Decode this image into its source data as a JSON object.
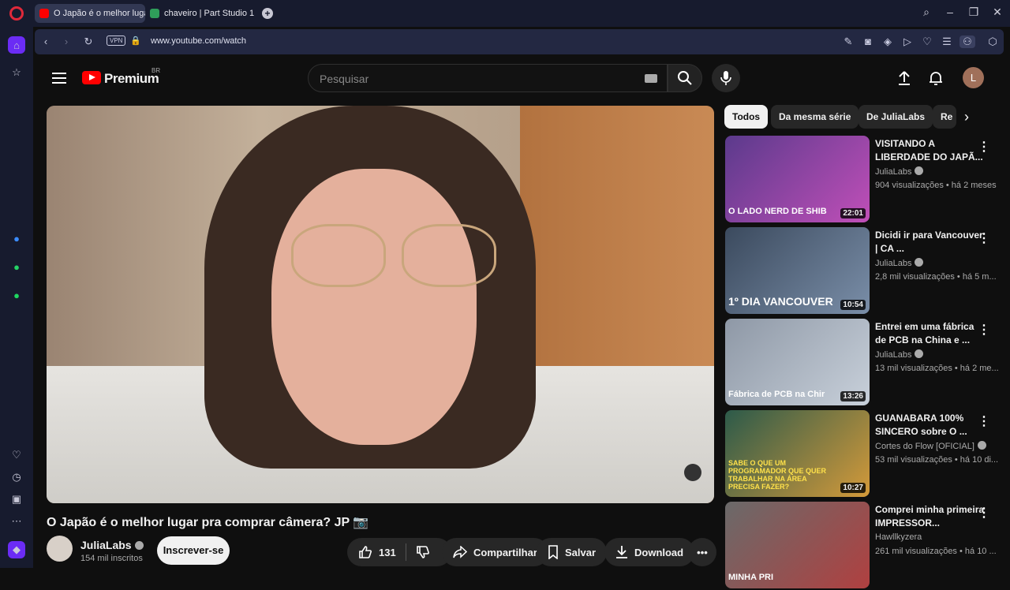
{
  "browser": {
    "tabs": [
      {
        "label": "O Japão é o melhor lugar",
        "active": true,
        "favicon_color": "#ff0000"
      },
      {
        "label": "chaveiro | Part Studio 1",
        "active": false,
        "favicon_color": "#2f9e5a"
      }
    ],
    "new_tab_glyph": "+",
    "url": "www.youtube.com/watch",
    "vpn_label": "VPN"
  },
  "sidebar": {
    "items": [
      "home-icon",
      "star-icon",
      "messenger-icon",
      "whatsapp-icon",
      "spotify-icon",
      "heart-icon",
      "history-icon",
      "gift-icon",
      "more-icon",
      "notifications-icon"
    ]
  },
  "youtube": {
    "logo_text": "Premium",
    "logo_region": "BR",
    "search_placeholder": "Pesquisar",
    "user_initial": "L",
    "video": {
      "title": "O Japão é o melhor lugar pra comprar câmera? JP 📷",
      "channel": "JuliaLabs",
      "subscribers": "154 mil inscritos",
      "subscribe_label": "Inscrever-se",
      "likes": "131",
      "share_label": "Compartilhar",
      "save_label": "Salvar",
      "download_label": "Download"
    },
    "chips": [
      "Todos",
      "Da mesma série",
      "De JuliaLabs",
      "Re"
    ],
    "recommendations": [
      {
        "title": "VISITANDO A LIBERDADE DO JAPÃ...",
        "channel": "JuliaLabs",
        "meta": "904 visualizações • há 2 meses",
        "duration": "22:01",
        "thumb_text": "O LADO NERD DE SHIB",
        "thumb_color": "#5b3a8c"
      },
      {
        "title": "Dicidi ir para Vancouver | CA ...",
        "channel": "JuliaLabs",
        "meta": "2,8 mil visualizações • há 5 m...",
        "duration": "10:54",
        "thumb_text": "1º DIA VANCOUVER",
        "thumb_color": "#3b4a5e"
      },
      {
        "title": "Entrei em uma fábrica de PCB na China e ...",
        "channel": "JuliaLabs",
        "meta": "13 mil visualizações • há 2 me...",
        "duration": "13:26",
        "thumb_text": "Fábrica de PCB na Chir",
        "thumb_color": "#8e98a6"
      },
      {
        "title": "GUANABARA 100% SINCERO sobre O ...",
        "channel": "Cortes do Flow [OFICIAL]",
        "meta": "53 mil visualizações • há 10 di...",
        "duration": "10:27",
        "thumb_text": "SABE O QUE UM PROGRAMADOR QUE QUER TRABALHAR NA ÁREA PRECISA FAZER?",
        "thumb_color": "#2c5a4a"
      },
      {
        "title": "Comprei minha primeira IMPRESSOR...",
        "channel": "Hawllkyzera",
        "meta": "261 mil visualizações • há 10 ...",
        "duration": "",
        "thumb_text": "MINHA PRI",
        "thumb_color": "#6a6a6a"
      }
    ]
  }
}
